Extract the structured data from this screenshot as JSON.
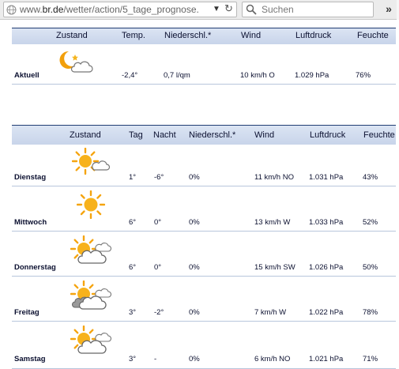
{
  "browser": {
    "url_prefix": "www.",
    "url_domain": "br.de",
    "url_path": "/wetter/action/5_tage_prognose.",
    "search_placeholder": "Suchen",
    "overflow_label": "»"
  },
  "current": {
    "headers": {
      "zustand": "Zustand",
      "temp": "Temp.",
      "niederschl": "Niederschl.*",
      "wind": "Wind",
      "luftdruck": "Luftdruck",
      "feuchte": "Feuchte"
    },
    "row": {
      "label": "Aktuell",
      "icon": "moon-cloud-icon",
      "temp": "-2,4°",
      "niederschl": "0,7 l/qm",
      "wind": "10 km/h O",
      "luftdruck": "1.029 hPa",
      "feuchte": "76%"
    }
  },
  "forecast": {
    "headers": {
      "zustand": "Zustand",
      "tag": "Tag",
      "nacht": "Nacht",
      "niederschl": "Niederschl.*",
      "wind": "Wind",
      "luftdruck": "Luftdruck",
      "feuchte": "Feuchte"
    },
    "days": [
      {
        "day": "Dienstag",
        "icon": "sun-small-cloud-icon",
        "tag": "1°",
        "nacht": "-6°",
        "niederschl": "0%",
        "wind": "11 km/h NO",
        "luftdruck": "1.031 hPa",
        "feuchte": "43%"
      },
      {
        "day": "Mittwoch",
        "icon": "sun-icon",
        "tag": "6°",
        "nacht": "0°",
        "niederschl": "0%",
        "wind": "13 km/h W",
        "luftdruck": "1.033 hPa",
        "feuchte": "52%"
      },
      {
        "day": "Donnerstag",
        "icon": "sun-cloud-icon",
        "tag": "6°",
        "nacht": "0°",
        "niederschl": "0%",
        "wind": "15 km/h SW",
        "luftdruck": "1.026 hPa",
        "feuchte": "50%"
      },
      {
        "day": "Freitag",
        "icon": "sun-dark-cloud-icon",
        "tag": "3°",
        "nacht": "-2°",
        "niederschl": "0%",
        "wind": "7 km/h W",
        "luftdruck": "1.022 hPa",
        "feuchte": "78%"
      },
      {
        "day": "Samstag",
        "icon": "sun-cloud-icon",
        "tag": "3°",
        "nacht": "-",
        "niederschl": "0%",
        "wind": "6 km/h NO",
        "luftdruck": "1.021 hPa",
        "feuchte": "71%"
      }
    ]
  }
}
